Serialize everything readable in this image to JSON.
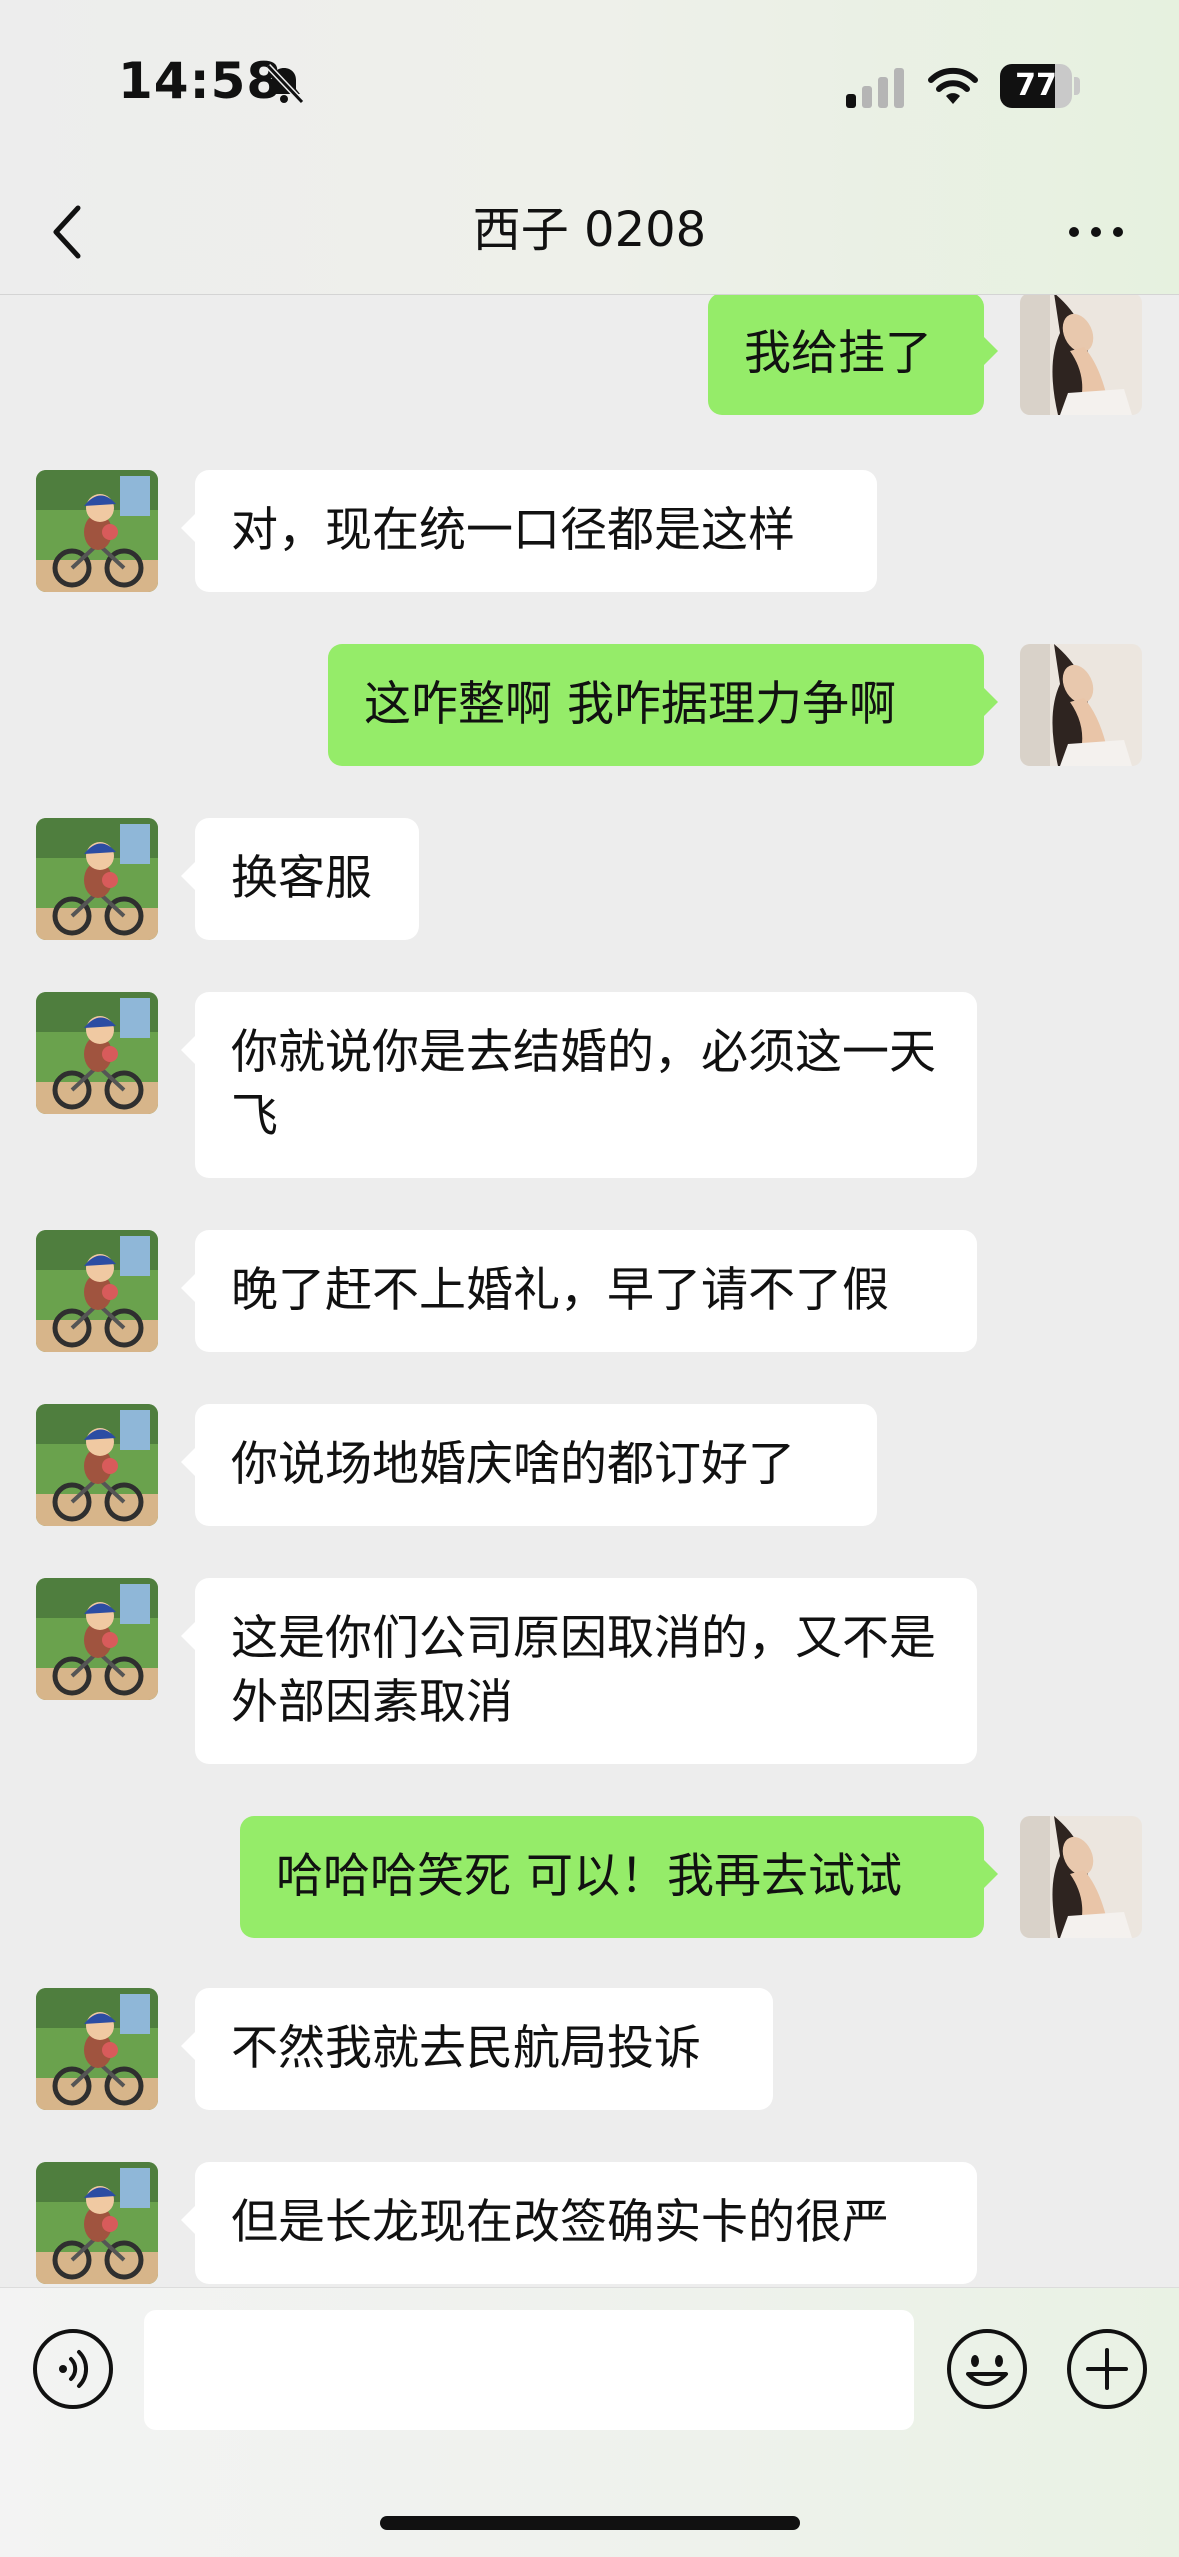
{
  "status_bar": {
    "time": "14:58",
    "battery": "77",
    "battery_level": 0.77,
    "icons": [
      "bell-slash-icon",
      "cellular-signal-icon",
      "wifi-icon",
      "battery-icon"
    ]
  },
  "nav": {
    "back_icon": "chevron-left-icon",
    "title": "西子 0208",
    "more_icon": "ellipsis-icon"
  },
  "messages": [
    {
      "side": "out",
      "text": "我给挂了"
    },
    {
      "side": "in",
      "text": "对，现在统一口径都是这样"
    },
    {
      "side": "out",
      "text": "这咋整啊  我咋据理力争啊"
    },
    {
      "side": "in",
      "text": "换客服"
    },
    {
      "side": "in",
      "text": "你就说你是去结婚的，必须这一天飞"
    },
    {
      "side": "in",
      "text": "晚了赶不上婚礼，早了请不了假"
    },
    {
      "side": "in",
      "text": "你说场地婚庆啥的都订好了"
    },
    {
      "side": "in",
      "text": "这是你们公司原因取消的，又不是外部因素取消"
    },
    {
      "side": "out",
      "text": "哈哈哈笑死 可以！我再去试试"
    },
    {
      "side": "in",
      "text": "不然我就去民航局投诉"
    },
    {
      "side": "in",
      "text": "但是长龙现在改签确实卡的很严"
    }
  ],
  "input_bar": {
    "text_value": "",
    "icons": [
      "voice-icon",
      "emoji-icon",
      "plus-icon"
    ]
  },
  "colors": {
    "background": "#ededed",
    "outgoing_bubble": "#95ec69",
    "incoming_bubble": "#ffffff"
  }
}
